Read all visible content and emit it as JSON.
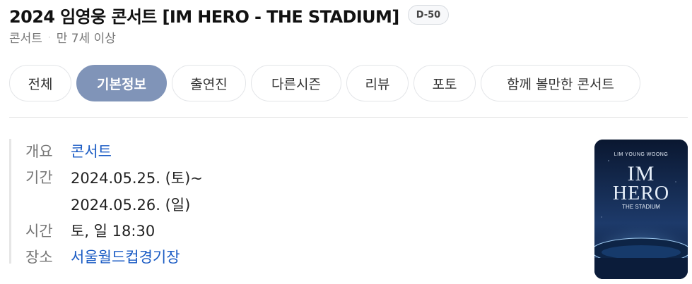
{
  "header": {
    "title": "2024 임영웅 콘서트 [IM HERO - THE STADIUM]",
    "dday_badge": "D-50"
  },
  "subline": {
    "category": "콘서트",
    "separator": "·",
    "age_rating": "만 7세 이상"
  },
  "tabs": [
    {
      "label": "전체",
      "active": false
    },
    {
      "label": "기본정보",
      "active": true
    },
    {
      "label": "출연진",
      "active": false
    },
    {
      "label": "다른시즌",
      "active": false
    },
    {
      "label": "리뷰",
      "active": false
    },
    {
      "label": "포토",
      "active": false
    },
    {
      "label": "함께 볼만한 콘서트",
      "active": false
    }
  ],
  "info": {
    "overview": {
      "label": "개요",
      "value": "콘서트"
    },
    "period": {
      "label": "기간",
      "start": "2024.05.25. (토)~",
      "end": "2024.05.26. (일)"
    },
    "time": {
      "label": "시간",
      "value": "토, 일 18:30"
    },
    "venue": {
      "label": "장소",
      "value": "서울월드컵경기장"
    }
  },
  "poster": {
    "artist": "LIM YOUNG WOONG",
    "line1": "IM",
    "line2": "HERO",
    "subtitle": "THE STADIUM",
    "colors": {
      "sky_top": "#0a1730",
      "sky_bottom": "#1d3a6a",
      "glow": "#bfe3ff",
      "text": "#e6eef8"
    }
  }
}
